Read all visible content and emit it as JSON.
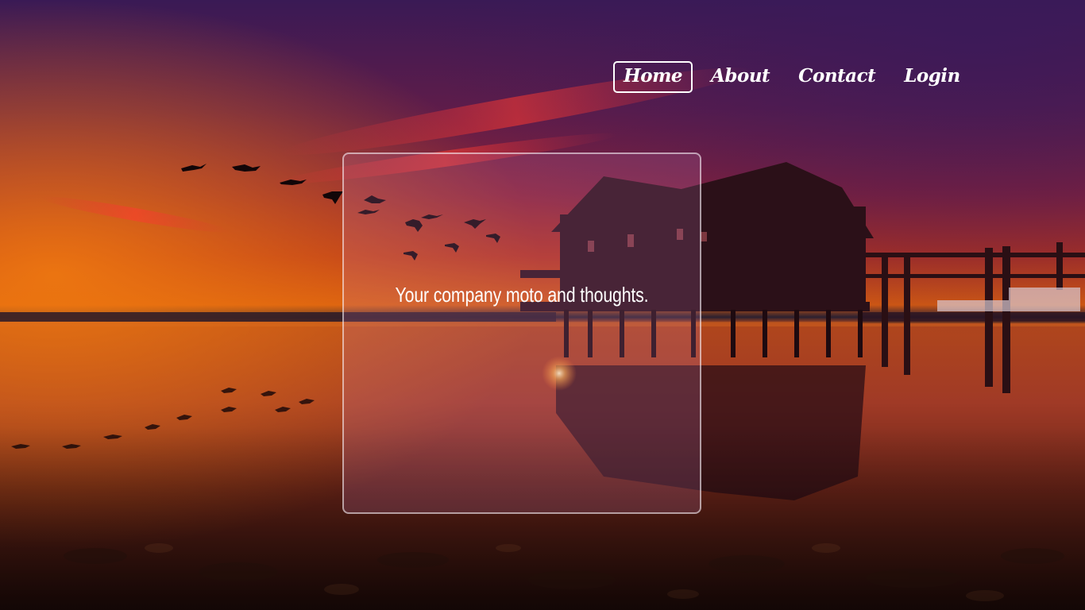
{
  "nav": {
    "items": [
      {
        "label": "Home",
        "active": true
      },
      {
        "label": "About",
        "active": false
      },
      {
        "label": "Contact",
        "active": false
      },
      {
        "label": "Login",
        "active": false
      }
    ]
  },
  "hero": {
    "moto": "Your company moto and thoughts."
  },
  "theme": {
    "text_color": "#ffffff",
    "sky_top": "#3d1a52",
    "sky_mid": "#c0243a",
    "horizon": "#e0641a",
    "water": "#5a2020"
  }
}
